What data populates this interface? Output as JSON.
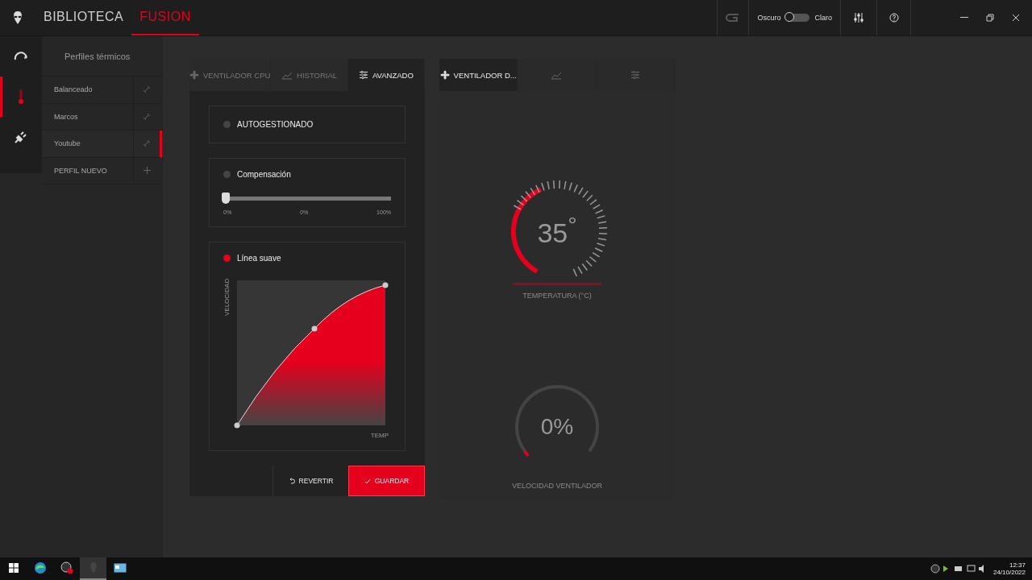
{
  "header": {
    "nav": [
      {
        "label": "BIBLIOTECA",
        "selected": false
      },
      {
        "label": "FUSION",
        "selected": true
      }
    ],
    "theme_toggle": {
      "left": "Oscuro",
      "right": "Claro",
      "on": false
    }
  },
  "side_icons": [
    {
      "kind": "speed",
      "selected": false
    },
    {
      "kind": "thermo",
      "selected": true
    },
    {
      "kind": "plug",
      "selected": false
    }
  ],
  "profiles": {
    "title": "Perfiles térmicos",
    "items": [
      {
        "label": "Balanceado",
        "kind": "link",
        "selected": false
      },
      {
        "label": "Marcos",
        "kind": "link",
        "selected": false
      },
      {
        "label": "Youtube",
        "kind": "link",
        "selected": true
      },
      {
        "label": "PERFIL NUEVO",
        "kind": "add",
        "selected": false
      }
    ]
  },
  "cpu_panel": {
    "tabs": [
      {
        "label": "VENTILADOR CPU",
        "kind": "fan",
        "selected": false
      },
      {
        "label": "HISTORIAL",
        "kind": "history",
        "selected": false
      },
      {
        "label": "AVANZADO",
        "kind": "advanced",
        "selected": true
      }
    ],
    "modes": [
      {
        "label": "AUTOGESTIONADO",
        "kind": "plain",
        "selected": false
      },
      {
        "label": "Compensación",
        "kind": "slider",
        "selected": false,
        "slider": {
          "level": 0,
          "labels": [
            "0%",
            "0%",
            "100%"
          ]
        }
      },
      {
        "label": "Línea suave",
        "kind": "curve",
        "selected": true,
        "ylabel": "VELOCIDAD",
        "xlabel": "TEMP"
      }
    ],
    "buttons": [
      {
        "label": "REVERTIR",
        "kind": "revert"
      },
      {
        "label": "GUARDAR",
        "kind": "save"
      }
    ]
  },
  "gpu_panel": {
    "tabs": [
      {
        "label": "VENTILADOR D...",
        "kind": "fan",
        "selected": true
      },
      {
        "kind": "history",
        "selected": false
      },
      {
        "kind": "advanced",
        "selected": false
      }
    ],
    "temperature": {
      "value": "35$^{°}$",
      "label": "TEMPERATURA (°C)"
    },
    "fan_speed": {
      "value": "0%",
      "label": "VELOCIDAD VENTILADOR"
    }
  },
  "taskbar": {
    "apps": [
      {
        "kind": "browser",
        "active": false
      },
      {
        "kind": "recorder",
        "active": false
      },
      {
        "kind": "alien",
        "active": true
      },
      {
        "kind": "window",
        "active": false
      }
    ],
    "time": "12:37",
    "date": "24/10/2022"
  }
}
